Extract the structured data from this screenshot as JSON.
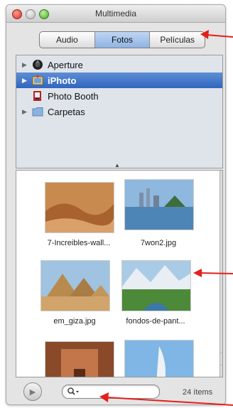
{
  "window": {
    "title": "Multimedia"
  },
  "tabs": [
    {
      "label": "Audio",
      "active": false
    },
    {
      "label": "Fotos",
      "active": true
    },
    {
      "label": "Películas",
      "active": false
    }
  ],
  "sources": [
    {
      "label": "Aperture",
      "icon": "aperture-icon",
      "expandable": true,
      "selected": false
    },
    {
      "label": "iPhoto",
      "icon": "iphoto-icon",
      "expandable": true,
      "selected": true
    },
    {
      "label": "Photo Booth",
      "icon": "photo-booth-icon",
      "expandable": false,
      "selected": false
    },
    {
      "label": "Carpetas",
      "icon": "folder-icon",
      "expandable": true,
      "selected": false
    }
  ],
  "photos": [
    {
      "caption": "7-Increibles-wall...",
      "thumb": "desert-dunes"
    },
    {
      "caption": "7won2.jpg",
      "thumb": "lake-skyline"
    },
    {
      "caption": "em_giza.jpg",
      "thumb": "pyramids"
    },
    {
      "caption": "fondos-de-pant...",
      "thumb": "mountain-valley"
    },
    {
      "caption": "",
      "thumb": "petra"
    },
    {
      "caption": "",
      "thumb": "burj-al-arab"
    }
  ],
  "footer": {
    "item_count": "24 ítems"
  },
  "colors": {
    "selection": "#3a6fc4",
    "active_tab": "#9dbde8",
    "annotation_arrow": "#e3201b"
  }
}
